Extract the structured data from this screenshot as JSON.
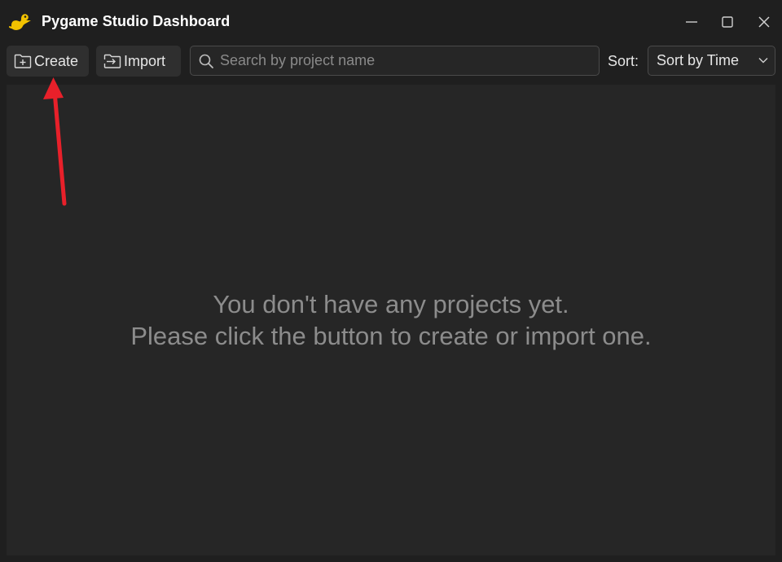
{
  "window": {
    "title": "Pygame Studio Dashboard",
    "logo_icon": "python-snake-logo",
    "controls": [
      "minimize-icon",
      "maximize-icon",
      "close-icon"
    ]
  },
  "toolbar": {
    "create_label": "Create",
    "create_icon": "folder-plus-icon",
    "import_label": "Import",
    "import_icon": "folder-import-icon",
    "search_placeholder": "Search by project name",
    "search_value": "",
    "sort_label": "Sort:",
    "sort_value": "Sort by Time"
  },
  "content": {
    "empty_line1": "You don't have any projects yet.",
    "empty_line2": "Please click the button to create or import one."
  },
  "colors": {
    "background": "#1f1f1f",
    "panel": "#262626",
    "button": "#2f2f2f",
    "text": "#e6e6e6",
    "muted_text": "#8c8c8c",
    "annotation": "#e8202a",
    "logo_yellow": "#f2c200"
  }
}
